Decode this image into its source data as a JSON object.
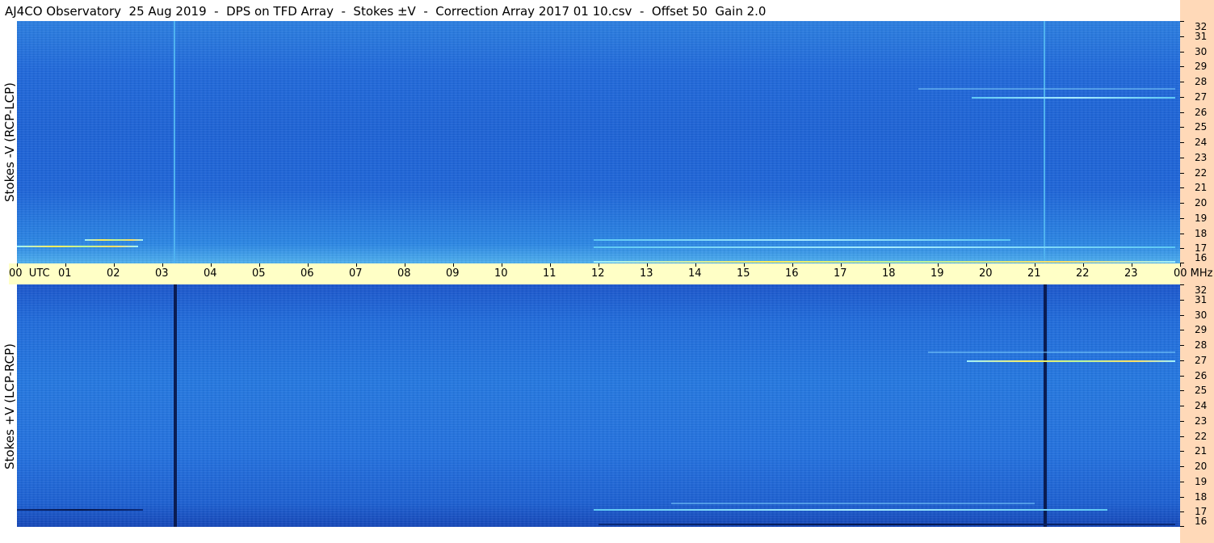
{
  "title": "AJ4CO Observatory  25 Aug 2019  -  DPS on TFD Array  -  Stokes ±V  -  Correction Array 2017 01 10.csv  -  Offset 50  Gain 2.0",
  "panels": {
    "top_label": "Stokes -V (RCP-LCP)",
    "bottom_label": "Stokes +V (LCP-RCP)"
  },
  "time_axis": {
    "labels": [
      "00  UTC",
      "01",
      "02",
      "03",
      "04",
      "05",
      "06",
      "07",
      "08",
      "09",
      "10",
      "11",
      "12",
      "13",
      "14",
      "15",
      "16",
      "17",
      "18",
      "19",
      "20",
      "21",
      "22",
      "23",
      "00 MHz"
    ]
  },
  "colors": {
    "axis_bg": "#ffffc6",
    "freq_axis_bg": "#ffd9b8",
    "spectrogram_base": "#1f68da"
  },
  "chart_data": {
    "type": "heatmap",
    "title": "AJ4CO Observatory  25 Aug 2019  -  DPS on TFD Array  -  Stokes ±V  -  Correction Array 2017 01 10.csv  -  Offset 50  Gain 2.0",
    "x_unit": "UTC",
    "x_range": [
      0,
      24
    ],
    "x_ticks": [
      "00",
      "01",
      "02",
      "03",
      "04",
      "05",
      "06",
      "07",
      "08",
      "09",
      "10",
      "11",
      "12",
      "13",
      "14",
      "15",
      "16",
      "17",
      "18",
      "19",
      "20",
      "21",
      "22",
      "23",
      "00"
    ],
    "y_unit": "MHz",
    "y_range": [
      16,
      32
    ],
    "y_ticks": [
      32,
      31,
      30,
      29,
      28,
      27,
      26,
      25,
      24,
      23,
      22,
      21,
      20,
      19,
      18,
      17,
      16
    ],
    "panels": [
      {
        "name": "Stokes -V (RCP-LCP)",
        "vertical_lines_utc": [
          3.25,
          21.2
        ],
        "vertical_line_style": "light",
        "features": [
          {
            "utc_start": 11.9,
            "utc_end": 23.9,
            "mhz": 16.1,
            "intensity": "high"
          },
          {
            "utc_start": 11.9,
            "utc_end": 23.9,
            "mhz": 17.1,
            "intensity": "medium"
          },
          {
            "utc_start": 11.9,
            "utc_end": 20.5,
            "mhz": 17.6,
            "intensity": "medium"
          },
          {
            "utc_start": 0.0,
            "utc_end": 2.5,
            "mhz": 17.2,
            "intensity": "high"
          },
          {
            "utc_start": 1.4,
            "utc_end": 2.6,
            "mhz": 17.6,
            "intensity": "high"
          },
          {
            "utc_start": 19.7,
            "utc_end": 23.9,
            "mhz": 27.0,
            "intensity": "medium"
          },
          {
            "utc_start": 18.6,
            "utc_end": 23.9,
            "mhz": 27.6,
            "intensity": "low"
          }
        ]
      },
      {
        "name": "Stokes +V (LCP-RCP)",
        "vertical_lines_utc": [
          3.25,
          21.2
        ],
        "vertical_line_style": "dark",
        "features": [
          {
            "utc_start": 12.0,
            "utc_end": 23.9,
            "mhz": 16.2,
            "intensity": "dark"
          },
          {
            "utc_start": 11.9,
            "utc_end": 22.5,
            "mhz": 17.2,
            "intensity": "medium"
          },
          {
            "utc_start": 13.5,
            "utc_end": 21.0,
            "mhz": 17.6,
            "intensity": "low"
          },
          {
            "utc_start": 0.0,
            "utc_end": 2.6,
            "mhz": 17.2,
            "intensity": "dark"
          },
          {
            "utc_start": 19.6,
            "utc_end": 23.9,
            "mhz": 27.0,
            "intensity": "high"
          },
          {
            "utc_start": 18.8,
            "utc_end": 23.9,
            "mhz": 27.6,
            "intensity": "low"
          }
        ]
      }
    ]
  }
}
